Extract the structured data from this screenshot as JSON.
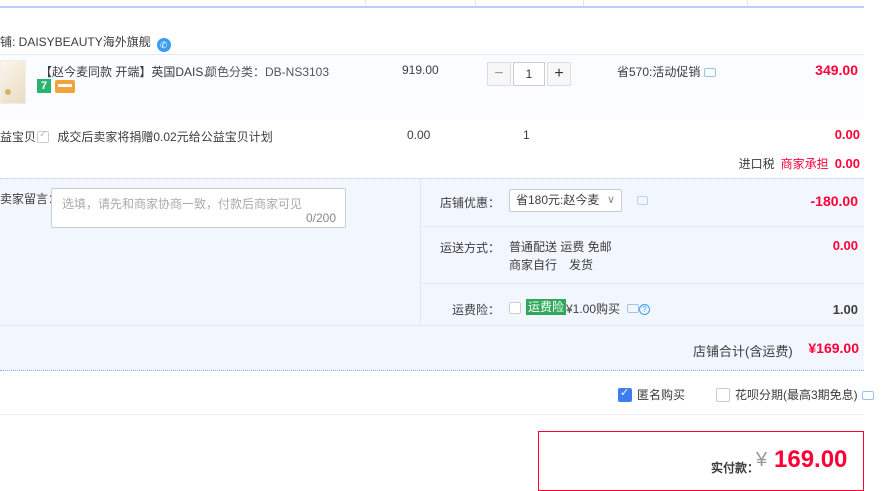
{
  "shop": {
    "name": "铺: DAISYBEAUTY海外旗舰",
    "ww_icon": "wangwang-icon"
  },
  "item": {
    "title": "【赵今麦同款 开端】英国DAIS...",
    "sku": "颜色分类：DB-NS3103",
    "price": "919.00",
    "quantity": "1",
    "minus": "−",
    "plus": "+",
    "promo": "省570:活动促销",
    "subtotal": "349.00",
    "tag_7day": "7"
  },
  "charity": {
    "label": "益宝贝",
    "desc": "成交后卖家将捐赠0.02元给公益宝贝计划",
    "price": "0.00",
    "quantity": "1",
    "subtotal": "0.00"
  },
  "tax": {
    "label": "进口税",
    "bearer": "商家承担",
    "value": "0.00"
  },
  "message": {
    "label": "卖家留言：",
    "placeholder": "选填，请先和商家协商一致，付款后商家可见",
    "counter": "0/200"
  },
  "shop_discount": {
    "label": "店铺优惠：",
    "selected": "省180元:赵今麦",
    "value": "-180.00"
  },
  "shipping": {
    "label": "运送方式：",
    "line1": "普通配送 运费 免邮",
    "line2": "商家自行　发货",
    "value": "0.00"
  },
  "insurance": {
    "label": "运费险：",
    "badge": "运费险",
    "price": "¥1.00购买",
    "help": "?",
    "value": "1.00"
  },
  "shop_total": {
    "label": "店铺合计(含运费)",
    "value": "¥169.00"
  },
  "options": {
    "anonymous": "匿名购买",
    "huabei": "花呗分期(最高3期免息)"
  },
  "payment": {
    "label": "实付款：",
    "currency": "¥",
    "value": "169.00"
  },
  "colors": {
    "accent_red": "#ff0036",
    "blue": "#3d7df4",
    "panel_bg": "#f2f7ff"
  }
}
